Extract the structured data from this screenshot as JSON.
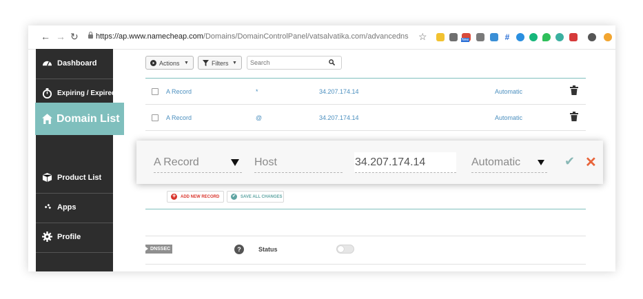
{
  "browser": {
    "url_host": "https://ap.www.namecheap.com",
    "url_path": "/Domains/DomainControlPanel/vatsalvatika.com/advancedns",
    "icons": [
      "back-icon",
      "forward-icon",
      "reload-icon",
      "lock-icon",
      "bookmark-star-icon"
    ],
    "extension_badge": "New"
  },
  "sidebar": {
    "items": [
      {
        "label": "Dashboard",
        "icon": "dashboard-gauge-icon"
      },
      {
        "label": "Expiring / Expired",
        "icon": "stopwatch-icon"
      },
      {
        "label": "Domain List",
        "icon": "home-icon",
        "active": true
      },
      {
        "label": "Product List",
        "icon": "box-icon"
      },
      {
        "label": "Apps",
        "icon": "apps-diamonds-icon"
      },
      {
        "label": "Profile",
        "icon": "gear-icon"
      }
    ]
  },
  "toolbar": {
    "actions_label": "Actions",
    "filters_label": "Filters",
    "search_placeholder": "Search"
  },
  "records": [
    {
      "type": "A Record",
      "host": "*",
      "value": "34.207.174.14",
      "ttl": "Automatic"
    },
    {
      "type": "A Record",
      "host": "@",
      "value": "34.207.174.14",
      "ttl": "Automatic"
    }
  ],
  "edit_row": {
    "type": "A Record",
    "host_placeholder": "Host",
    "value": "34.207.174.14",
    "ttl": "Automatic"
  },
  "actions": {
    "add_new_record": "ADD NEW RECORD",
    "save_all_changes": "SAVE ALL CHANGES"
  },
  "dnssec": {
    "label": "DNSSEC",
    "help": "?",
    "status_label": "Status"
  },
  "colors": {
    "sidebar_bg": "#2d2d2d",
    "active_item": "#7fbfbd",
    "link_text": "#4b8fbf",
    "cancel": "#e8643a",
    "confirm": "#89b8b6",
    "add_icon": "#d9342b"
  }
}
